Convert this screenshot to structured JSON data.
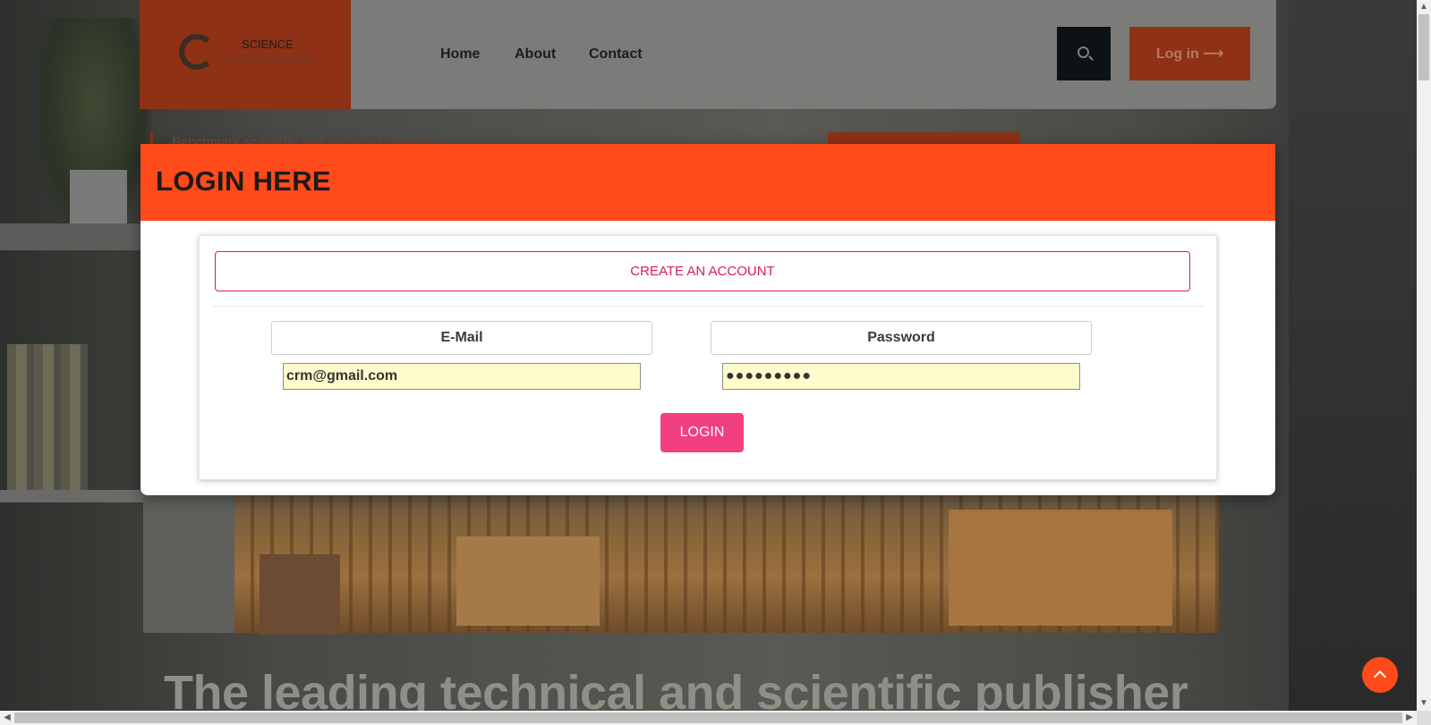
{
  "header": {
    "logo_line1": "SCIENCE",
    "logo_line2": "ET TECHNOLOGIE",
    "nav": [
      "Home",
      "About",
      "Contact"
    ],
    "login_label": "Log in ⟶"
  },
  "background": {
    "tagline": "Benchmark scientific and technical expertise",
    "hero_title": "The leading technical and scientific publisher"
  },
  "modal": {
    "title": "LOGIN HERE",
    "create_account_label": "CREATE AN ACCOUNT",
    "email_label": "E-Mail",
    "password_label": "Password",
    "email_value": "crm@gmail.com",
    "password_value": "●●●●●●●●●",
    "login_button": "LOGIN"
  },
  "colors": {
    "accent": "#ff4a1b",
    "pink": "#d81b60",
    "login_button": "#f23f7f",
    "autofill": "#fffbcc"
  },
  "icons": [
    "search-icon",
    "arrow-up-icon",
    "logo-icon"
  ]
}
